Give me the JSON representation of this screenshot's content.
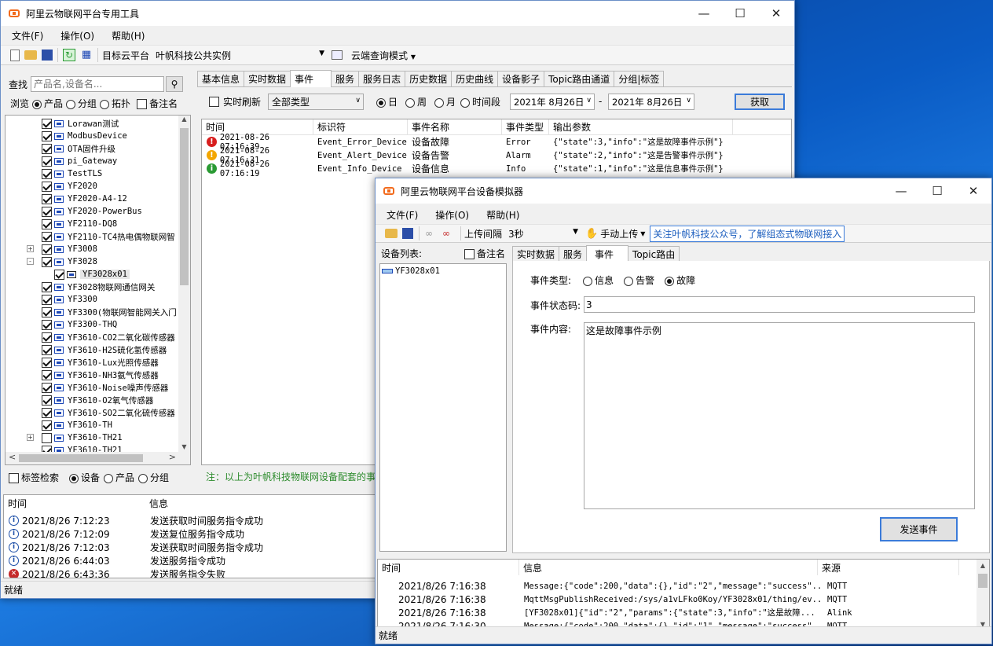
{
  "main": {
    "title": "阿里云物联网平台专用工具",
    "menu": [
      "文件(F)",
      "操作(O)",
      "帮助(H)"
    ],
    "target_label": "目标云平台",
    "target_value": "叶帆科技公共实例",
    "mode_label": "云端查询模式",
    "search_label": "查找",
    "search_placeholder": "产品名,设备名...",
    "browse_label": "浏览",
    "browse_options": [
      "产品",
      "分组",
      "拓扑"
    ],
    "note_label": "备注名",
    "tree": [
      {
        "label": "Lorawan测试",
        "checked": true
      },
      {
        "label": "ModbusDevice",
        "checked": true
      },
      {
        "label": "OTA固件升级",
        "checked": true
      },
      {
        "label": "pi_Gateway",
        "checked": true
      },
      {
        "label": "TestTLS",
        "checked": true
      },
      {
        "label": "YF2020",
        "checked": true
      },
      {
        "label": "YF2020-A4-12",
        "checked": true
      },
      {
        "label": "YF2020-PowerBus",
        "checked": true
      },
      {
        "label": "YF2110-DQ8",
        "checked": true
      },
      {
        "label": "YF2110-TC4热电偶物联网智",
        "checked": true
      },
      {
        "label": "YF3008",
        "checked": true,
        "expander": "+"
      },
      {
        "label": "YF3028",
        "checked": true,
        "expander": "-"
      },
      {
        "label": "YF3028x01",
        "checked": true,
        "child": true
      },
      {
        "label": "YF3028物联网通信网关",
        "checked": true
      },
      {
        "label": "YF3300",
        "checked": true
      },
      {
        "label": "YF3300(物联网智能网关入门",
        "checked": true
      },
      {
        "label": "YF3300-THQ",
        "checked": true
      },
      {
        "label": "YF3610-CO2二氧化碳传感器",
        "checked": true
      },
      {
        "label": "YF3610-H2S硫化氢传感器",
        "checked": true
      },
      {
        "label": "YF3610-Lux光照传感器",
        "checked": true
      },
      {
        "label": "YF3610-NH3氨气传感器",
        "checked": true
      },
      {
        "label": "YF3610-Noise噪声传感器",
        "checked": true
      },
      {
        "label": "YF3610-O2氧气传感器",
        "checked": true
      },
      {
        "label": "YF3610-SO2二氧化硫传感器",
        "checked": true
      },
      {
        "label": "YF3610-TH",
        "checked": true
      },
      {
        "label": "YF3610-TH21",
        "checked": false,
        "expander": "+"
      },
      {
        "label": "YF3610-TH21",
        "checked": true
      }
    ],
    "filter_label": "标签检索",
    "filter_options": [
      "设备",
      "产品",
      "分组"
    ],
    "tabs": [
      "基本信息",
      "实时数据",
      "事件",
      "服务",
      "服务日志",
      "历史数据",
      "历史曲线",
      "设备影子",
      "Topic路由通道",
      "分组|标签"
    ],
    "active_tab": "事件",
    "realtime_label": "实时刷新",
    "type_select": "全部类型",
    "period_options": [
      "日",
      "周",
      "月",
      "时间段"
    ],
    "date_from": "2021年 8月26日",
    "date_to": "2021年 8月26日",
    "date_sep": "-",
    "fetch_button": "获取",
    "event_headers": [
      "时间",
      "标识符",
      "事件名称",
      "事件类型",
      "输出参数"
    ],
    "events": [
      {
        "icon": "error",
        "time": "2021-08-26 07:16:39",
        "id": "Event_Error_Device",
        "name": "设备故障",
        "type": "Error",
        "params": "{\"state\":3,\"info\":\"这是故障事件示例\"}"
      },
      {
        "icon": "warn",
        "time": "2021-08-26 07:16:31",
        "id": "Event_Alert_Device",
        "name": "设备告警",
        "type": "Alarm",
        "params": "{\"state\":2,\"info\":\"这是告警事件示例\"}"
      },
      {
        "icon": "info",
        "time": "2021-08-26 07:16:19",
        "id": "Event_Info_Device",
        "name": "设备信息",
        "type": "Info",
        "params": "{\"state\":1,\"info\":\"这是信息事件示例\"}"
      }
    ],
    "note": "注：以上为叶帆科技物联网设备配套的事",
    "log_headers": [
      "时间",
      "信息"
    ],
    "logs": [
      {
        "icon": "info",
        "time": "2021/8/26 7:12:23",
        "msg": "发送获取时间服务指令成功"
      },
      {
        "icon": "info",
        "time": "2021/8/26 7:12:09",
        "msg": "发送复位服务指令成功"
      },
      {
        "icon": "info",
        "time": "2021/8/26 7:12:03",
        "msg": "发送获取时间服务指令成功"
      },
      {
        "icon": "info",
        "time": "2021/8/26 6:44:03",
        "msg": "发送服务指令成功"
      },
      {
        "icon": "error",
        "time": "2021/8/26 6:43:36",
        "msg": "发送服务指令失败"
      }
    ],
    "status": "就绪"
  },
  "sim": {
    "title": "阿里云物联网平台设备模拟器",
    "menu": [
      "文件(F)",
      "操作(O)",
      "帮助(H)"
    ],
    "interval_label": "上传间隔",
    "interval_value": "3秒",
    "manual_label": "手动上传",
    "banner": "关注叶帆科技公众号，了解组态式物联网接入",
    "device_list_label": "设备列表:",
    "note_label": "备注名",
    "devices": [
      "YF3028x01"
    ],
    "tabs": [
      "实时数据",
      "服务",
      "事件",
      "Topic路由"
    ],
    "active_tab": "事件",
    "event_type_label": "事件类型:",
    "event_types": [
      "信息",
      "告警",
      "故障"
    ],
    "event_type_selected": "故障",
    "state_label": "事件状态码:",
    "state_value": "3",
    "content_label": "事件内容:",
    "content_value": "这是故障事件示例",
    "send_button": "发送事件",
    "log_headers": [
      "时间",
      "信息",
      "来源"
    ],
    "logs": [
      {
        "time": "2021/8/26 7:16:38",
        "msg": "Message:{\"code\":200,\"data\":{},\"id\":\"2\",\"message\":\"success\"...",
        "src": "MQTT"
      },
      {
        "time": "2021/8/26 7:16:38",
        "msg": "MqttMsgPublishReceived:/sys/a1vLFko0Koy/YF3028x01/thing/ev...",
        "src": "MQTT"
      },
      {
        "time": "2021/8/26 7:16:38",
        "msg": "[YF3028x01]{\"id\":\"2\",\"params\":{\"state\":3,\"info\":\"这是故障...",
        "src": "Alink"
      },
      {
        "time": "2021/8/26 7:16:30",
        "msg": "Message:{\"code\":200,\"data\":{},\"id\":\"1\",\"message\":\"success\"...",
        "src": "MQTT"
      }
    ],
    "status": "就绪"
  }
}
